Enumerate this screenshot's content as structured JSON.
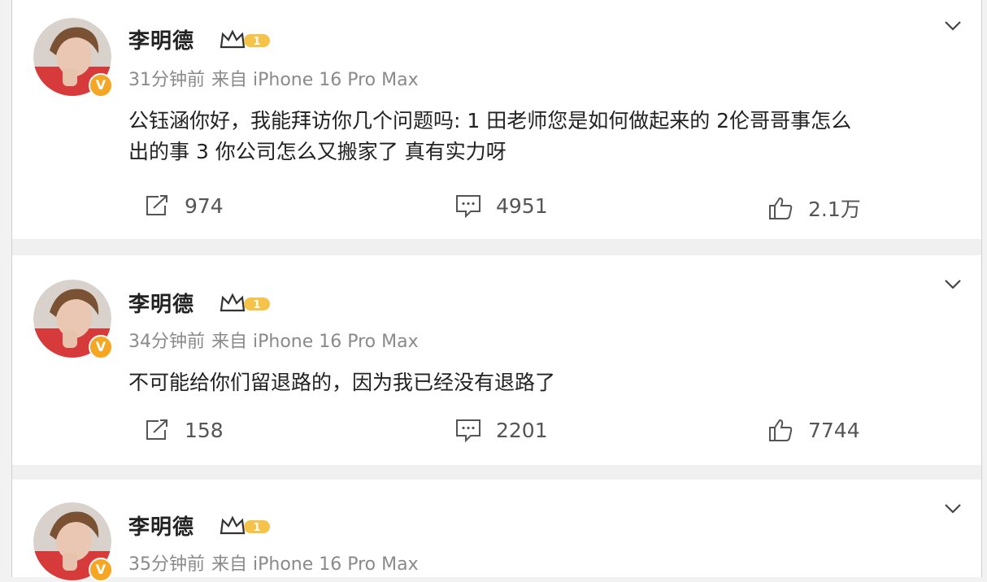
{
  "posts": [
    {
      "author": "李明德",
      "time": "31分钟前",
      "source": "来自 iPhone 16 Pro Max",
      "text_line1": "公钰涵你好，我能拜访你几个问题吗: 1 田老师您是如何做起来的 2伦哥哥事怎么",
      "text_line2": "出的事 3 你公司怎么又搬家了 真有实力呀",
      "repost_count": "974",
      "comment_count": "4951",
      "like_count": "2.1万"
    },
    {
      "author": "李明德",
      "time": "34分钟前",
      "source": "来自 iPhone 16 Pro Max",
      "text_line1": "不可能给你们留退路的，因为我已经没有退路了",
      "repost_count": "158",
      "comment_count": "2201",
      "like_count": "7744"
    },
    {
      "author": "李明德",
      "time": "35分钟前",
      "source": "来自 iPhone 16 Pro Max"
    }
  ],
  "badge": {
    "level": "1",
    "verified_mark": "V",
    "colors": {
      "gold": "#f5a623",
      "crown": "#e8a21a"
    }
  },
  "icons": {
    "repost": "repost-icon",
    "comment": "comment-icon",
    "like": "like-icon",
    "menu": "chevron-down-icon"
  }
}
